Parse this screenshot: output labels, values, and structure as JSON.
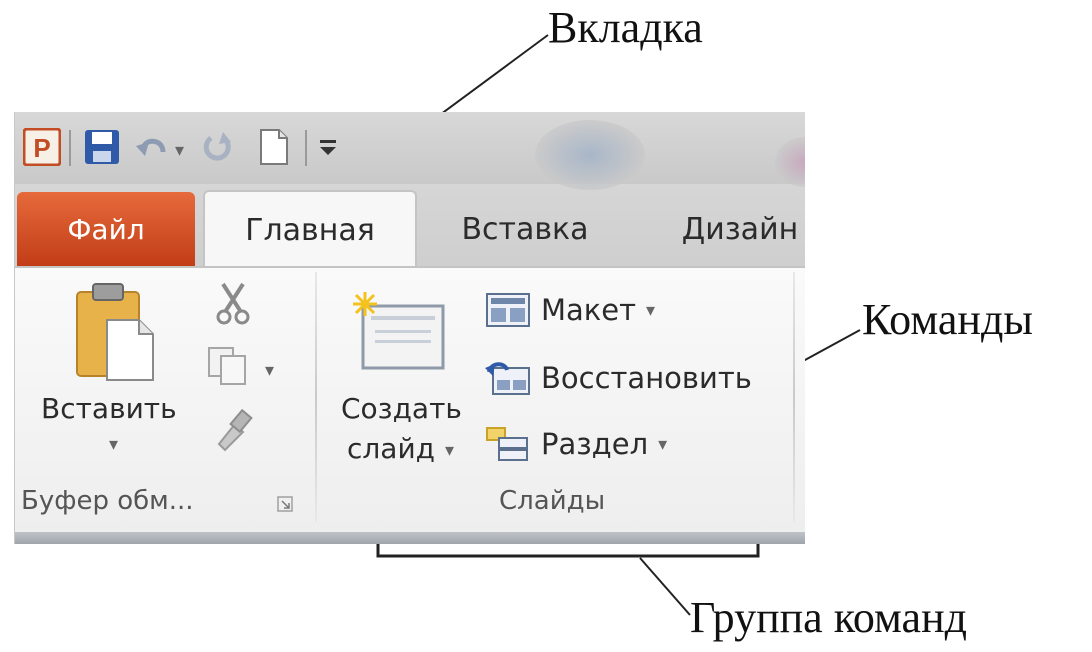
{
  "annotations": {
    "tab": "Вкладка",
    "commands": "Команды",
    "command_group": "Группа команд"
  },
  "quick_access": {
    "app_icon_letter": "P",
    "icons": [
      "powerpoint-icon",
      "save-icon",
      "undo-icon",
      "redo-icon",
      "new-document-icon",
      "customize-toolbar-icon"
    ]
  },
  "tabs": [
    {
      "label": "Файл",
      "active": false
    },
    {
      "label": "Главная",
      "active": true
    },
    {
      "label": "Вставка",
      "active": false
    },
    {
      "label": "Дизайн",
      "active": false
    }
  ],
  "groups": {
    "clipboard": {
      "paste_label": "Вставить",
      "group_label": "Буфер обм..."
    },
    "slides": {
      "new_slide_label_line1": "Создать",
      "new_slide_label_line2": "слайд",
      "commands": [
        "Макет",
        "Восстановить",
        "Раздел"
      ],
      "group_label": "Слайды"
    }
  },
  "colors": {
    "file_tab": "#d4532a",
    "accent_blue": "#3d6bb5"
  }
}
